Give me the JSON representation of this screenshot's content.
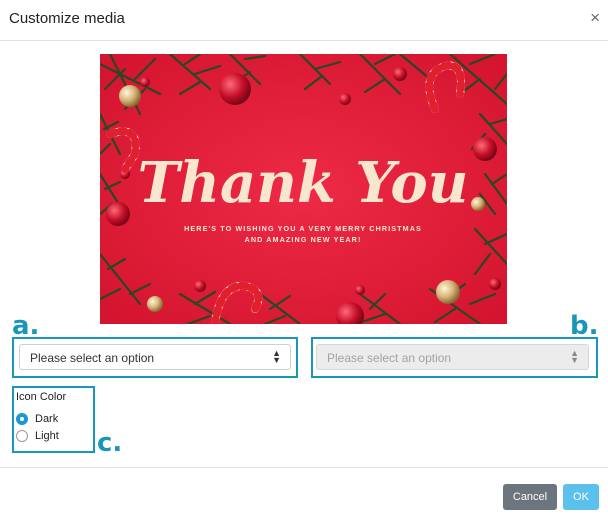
{
  "dialog": {
    "title": "Customize media",
    "close_glyph": "×"
  },
  "media": {
    "headline": "Thank You",
    "subline_1": "HERE'S TO WISHING YOU A VERY MERRY CHRISTMAS",
    "subline_2": "AND AMAZING NEW YEAR!",
    "background_color": "#e31e3c"
  },
  "callouts": {
    "a": "a.",
    "b": "b.",
    "c": "c."
  },
  "selects": {
    "first": {
      "placeholder": "Please select an option",
      "enabled": true
    },
    "second": {
      "placeholder": "Please select an option",
      "enabled": false
    }
  },
  "icon_color": {
    "title": "Icon Color",
    "options": [
      {
        "label": "Dark",
        "checked": true
      },
      {
        "label": "Light",
        "checked": false
      }
    ]
  },
  "footer": {
    "cancel_label": "Cancel",
    "ok_label": "OK"
  },
  "colors": {
    "accent": "#1a97b8",
    "cancel": "#6c757d",
    "ok": "#5bc0eb",
    "radio_checked": "#1a97d0"
  }
}
